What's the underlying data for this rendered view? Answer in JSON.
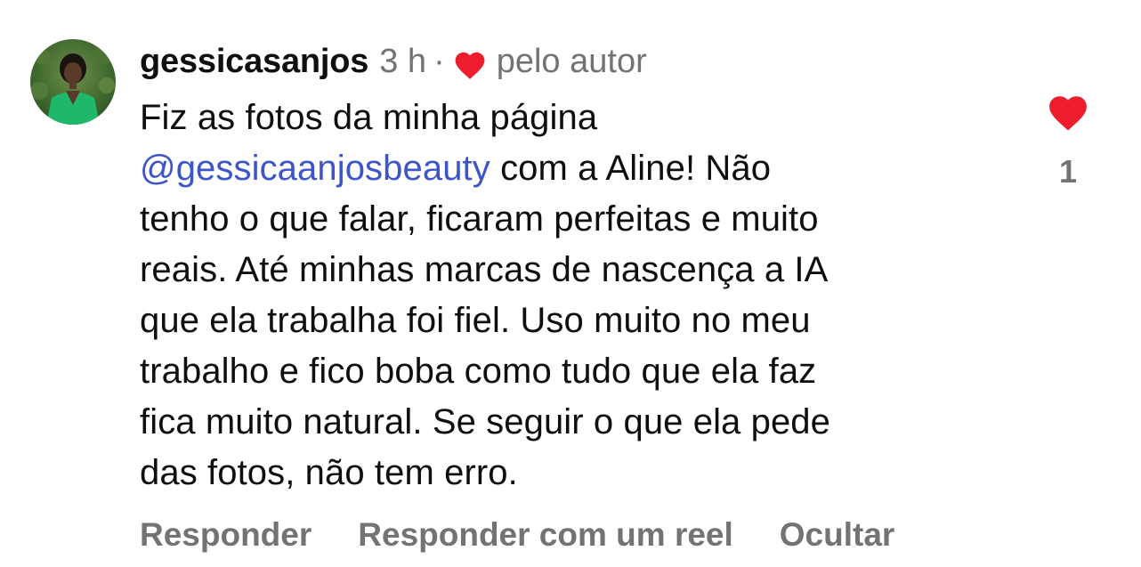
{
  "comment": {
    "username": "gessicasanjos",
    "time": "3 h",
    "separator": "·",
    "liked_by_author": "pelo autor",
    "body_lines": [
      {
        "prefix": "Fiz as fotos da minha página",
        "mention": "",
        "suffix": ""
      },
      {
        "prefix": "",
        "mention": "@gessicaanjosbeauty",
        "suffix": " com a Aline! Não"
      },
      {
        "prefix": "tenho o que falar, ficaram perfeitas e muito",
        "mention": "",
        "suffix": ""
      },
      {
        "prefix": "reais. Até minhas marcas de nascença a IA",
        "mention": "",
        "suffix": ""
      },
      {
        "prefix": "que ela trabalha foi fiel. Uso muito no meu",
        "mention": "",
        "suffix": ""
      },
      {
        "prefix": "trabalho e fico boba como tudo que ela faz",
        "mention": "",
        "suffix": ""
      },
      {
        "prefix": "fica muito natural. Se seguir o que ela pede",
        "mention": "",
        "suffix": ""
      },
      {
        "prefix": "das fotos, não tem erro.",
        "mention": "",
        "suffix": ""
      }
    ],
    "like_count": "1",
    "heart_color": "#ee1d2e",
    "mention_color": "#3d55c8",
    "muted_color": "#737373"
  },
  "actions": {
    "reply": "Responder",
    "reply_reel": "Responder com um reel",
    "hide": "Ocultar"
  },
  "icons": {
    "author_heart": "heart-icon",
    "like_heart": "heart-filled-icon"
  }
}
